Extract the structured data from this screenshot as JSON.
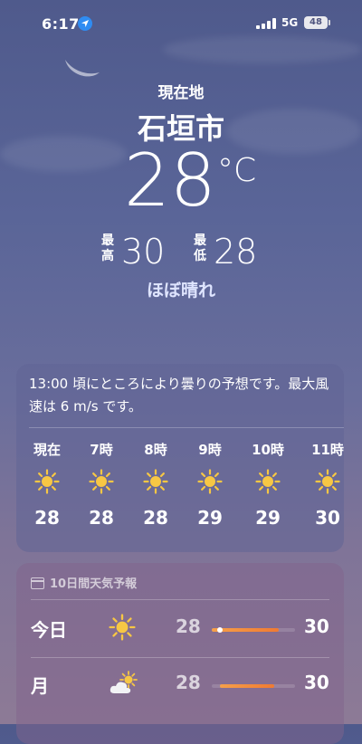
{
  "status_bar": {
    "time": "6:17",
    "network": "5G",
    "battery": "48"
  },
  "location": {
    "label": "現在地",
    "city": "石垣市"
  },
  "current": {
    "temp": "28",
    "unit": "°C",
    "high_label": "最高",
    "high": "30",
    "low_label": "最低",
    "low": "28",
    "condition": "ほぼ晴れ"
  },
  "hourly": {
    "summary": "13:00 頃にところにより曇りの予想です。最大風速は 6 m/s です。",
    "items": [
      {
        "time": "現在",
        "icon": "sun-icon",
        "temp": "28"
      },
      {
        "time": "7時",
        "icon": "sun-icon",
        "temp": "28"
      },
      {
        "time": "8時",
        "icon": "sun-icon",
        "temp": "28"
      },
      {
        "time": "9時",
        "icon": "sun-icon",
        "temp": "29"
      },
      {
        "time": "10時",
        "icon": "sun-icon",
        "temp": "29"
      },
      {
        "time": "11時",
        "icon": "sun-icon",
        "temp": "30"
      }
    ]
  },
  "forecast": {
    "title": "10日間天気予報",
    "days": [
      {
        "day": "今日",
        "icon": "sun-icon",
        "low": "28",
        "high": "30",
        "range_start": 0.0,
        "range_end": 0.8,
        "current_marker": 0.1
      },
      {
        "day": "月",
        "icon": "partly-cloudy-icon",
        "low": "28",
        "high": "30",
        "range_start": 0.1,
        "range_end": 0.75
      }
    ]
  },
  "colors": {
    "sun": "#f7c744",
    "bar": "#f07a32",
    "location_arrow": "#2f8cf2"
  }
}
